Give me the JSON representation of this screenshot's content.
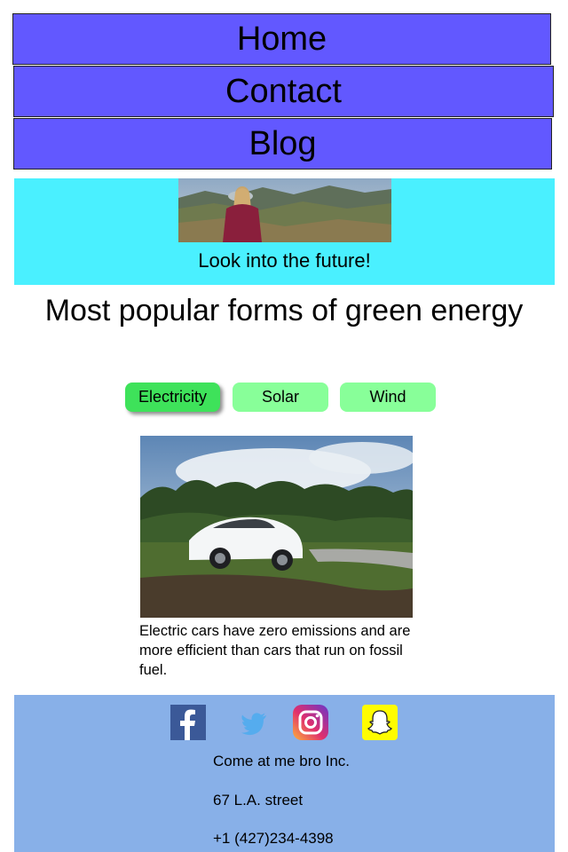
{
  "nav": {
    "home": "Home",
    "contact": "Contact",
    "blog": "Blog"
  },
  "hero": {
    "caption": "Look into the future!"
  },
  "main": {
    "heading": "Most popular forms of green energy",
    "tabs": [
      "Electricity",
      "Solar",
      "Wind"
    ],
    "active_tab": "Electricity",
    "description": "Electric cars have zero emissions and are more efficient than cars that run on fossil fuel."
  },
  "footer": {
    "social_icons": [
      "facebook-icon",
      "twitter-icon",
      "instagram-icon",
      "snapchat-icon"
    ],
    "company": "Come at me bro Inc.",
    "address": "67 L.A. street",
    "phone": "+1 (427)234-4398"
  },
  "colors": {
    "nav_bg": "#6258ff",
    "hero_bg": "#4af0ff",
    "tab_bg": "#88ff99",
    "tab_active_bg": "#3ee25a",
    "footer_bg": "#88b0e8"
  }
}
